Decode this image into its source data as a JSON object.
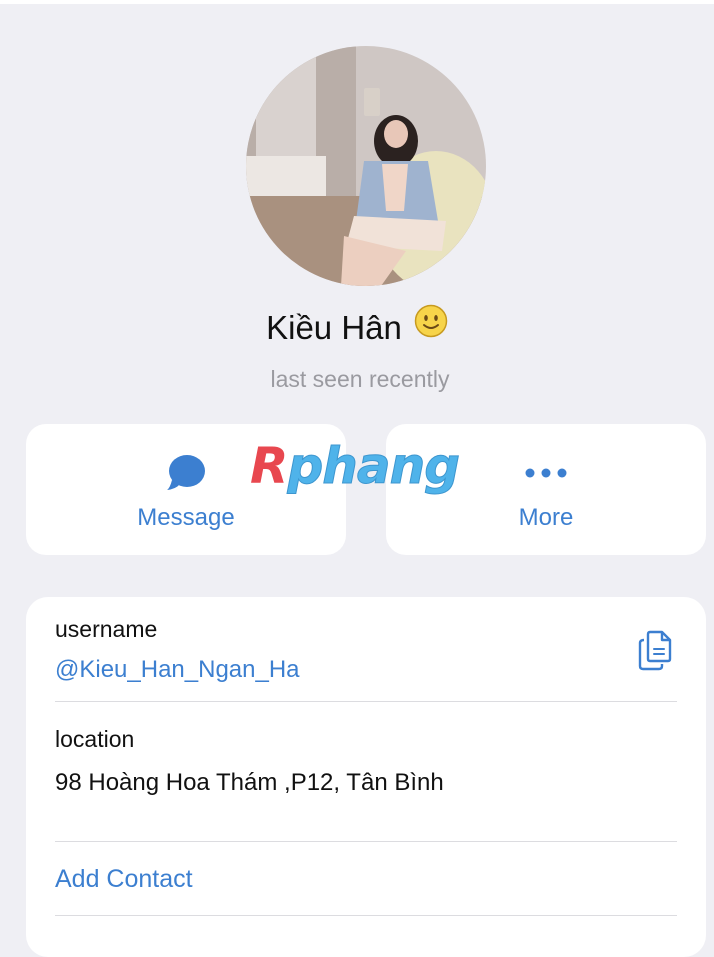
{
  "profile": {
    "name": "Kiều Hân",
    "name_emoji": "🙂",
    "status": "last seen recently"
  },
  "actions": {
    "message_label": "Message",
    "message_icon": "chat-bubble-icon",
    "more_label": "More",
    "more_icon": "ellipsis-icon"
  },
  "watermark": {
    "first": "R",
    "rest": "phang"
  },
  "info": {
    "username_title": "username",
    "username_value": "@Kieu_Han_Ngan_Ha",
    "copy_icon": "copy-icon",
    "location_title": "location",
    "location_value": "98 Hoàng Hoa Thám ,P12, Tân Bình",
    "add_contact_label": "Add Contact"
  },
  "colors": {
    "accent": "#3c7fd0",
    "background": "#efeff4",
    "card": "#ffffff",
    "secondary_text": "#9a9aa0"
  }
}
